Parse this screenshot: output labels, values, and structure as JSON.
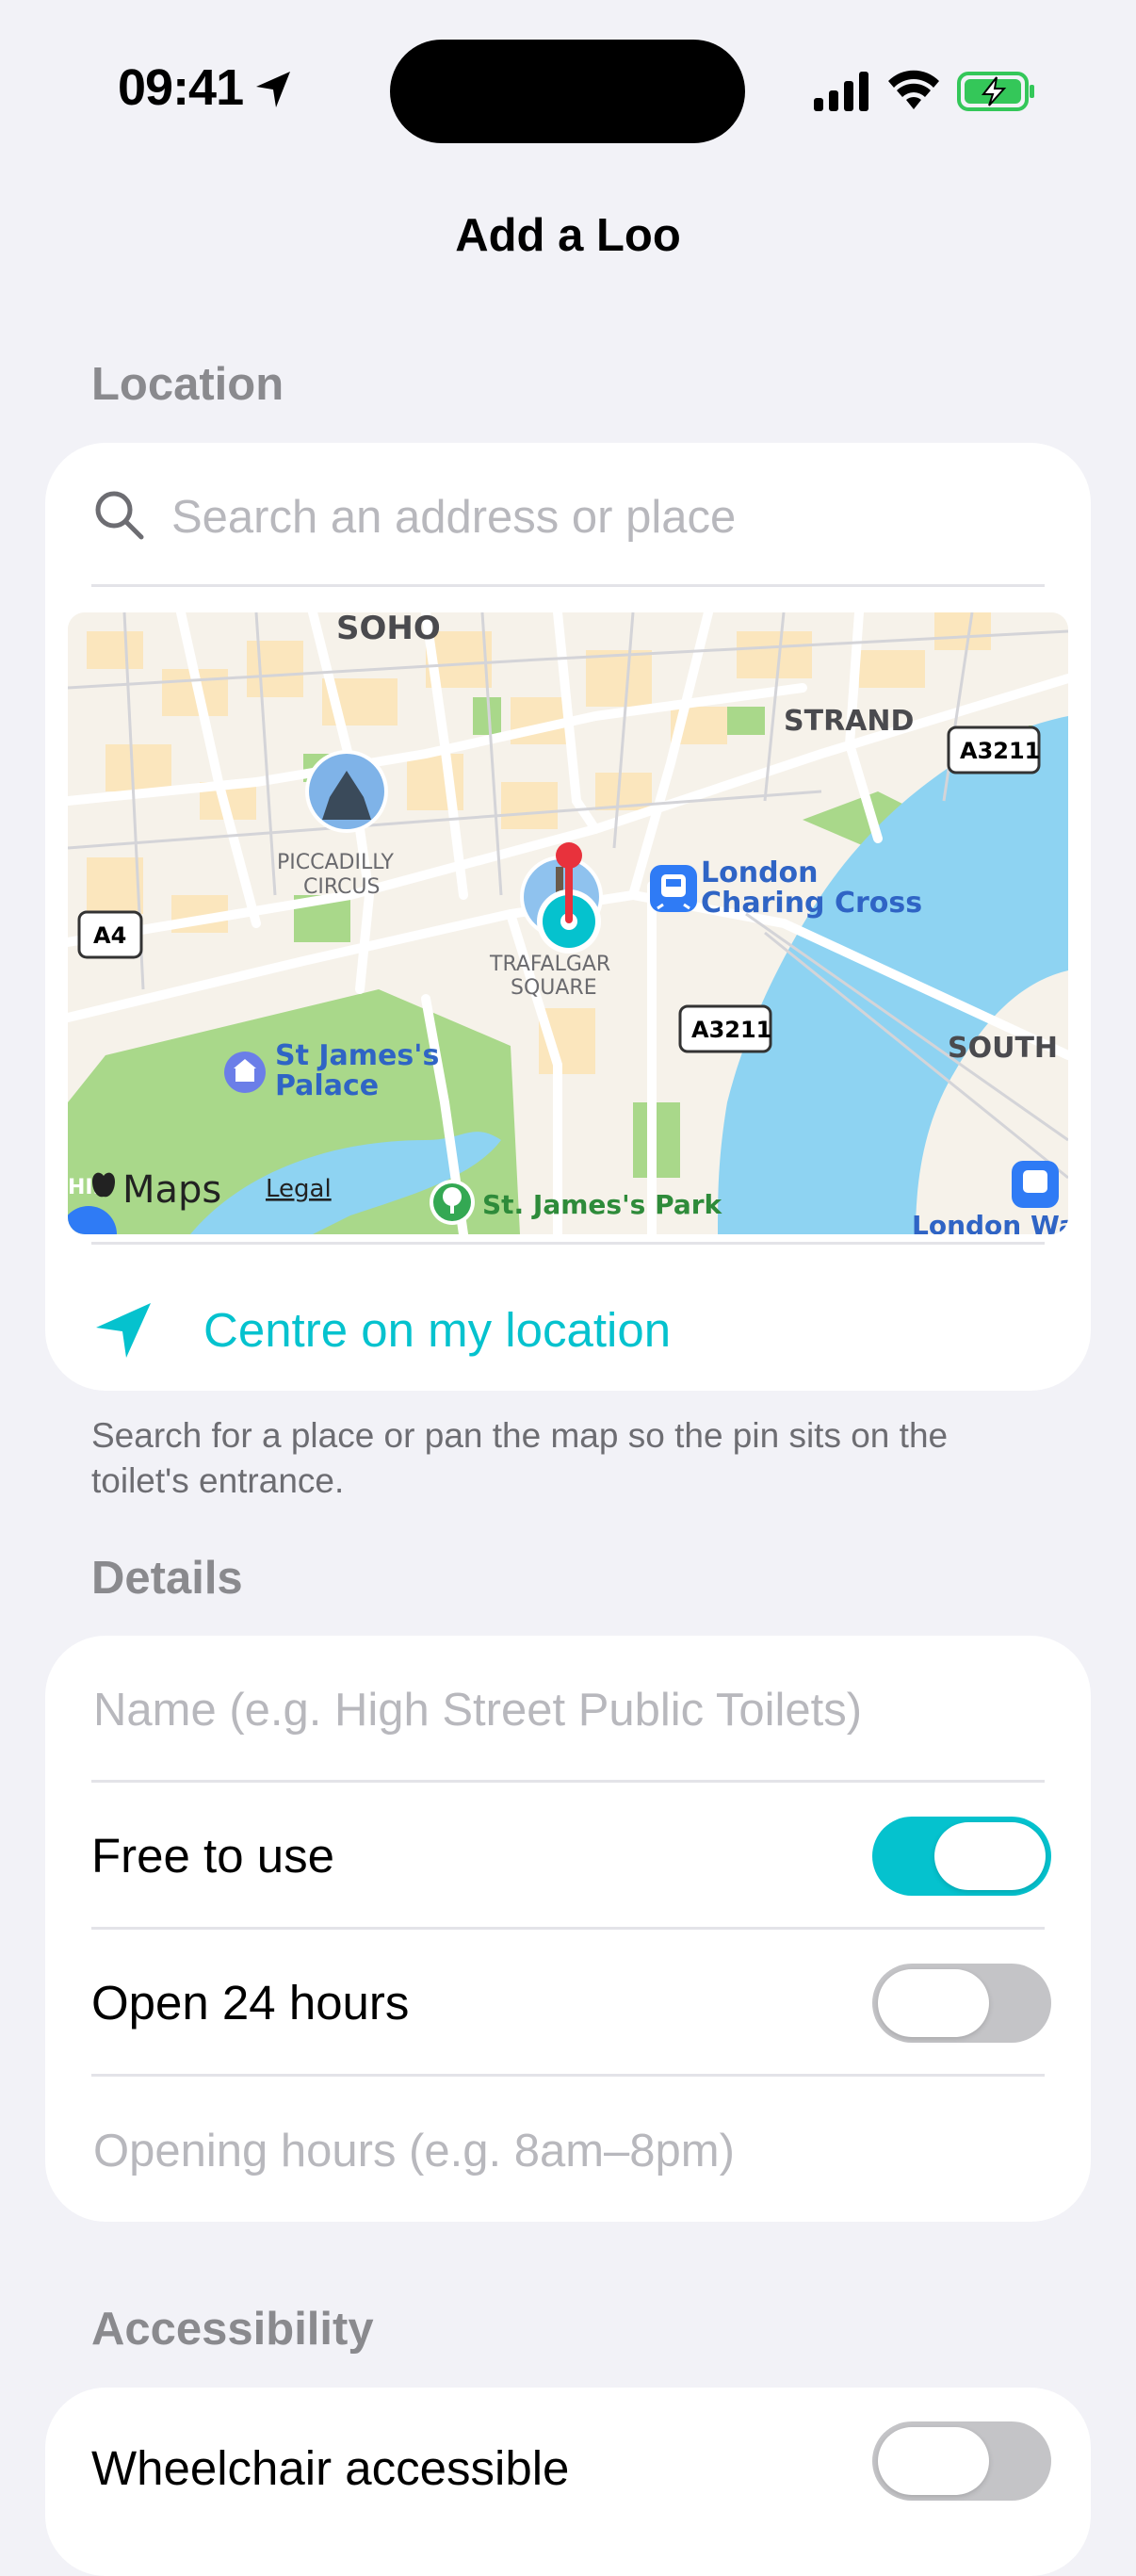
{
  "status_bar": {
    "time": "09:41"
  },
  "nav": {
    "title": "Add a Loo"
  },
  "location": {
    "header": "Location",
    "search_placeholder": "Search an address or place",
    "map": {
      "labels": {
        "soho": "SOHO",
        "strand": "STRAND",
        "a3211_top": "A3211",
        "a3211_mid": "A3211",
        "a4": "A4",
        "piccadilly_1": "PICCADILLY",
        "piccadilly_2": "CIRCUS",
        "trafalgar_1": "TRAFALGAR",
        "trafalgar_2": "SQUARE",
        "charing_1": "London",
        "charing_2": "Charing Cross",
        "stjames_palace_1": "St James's",
        "stjames_palace_2": "Palace",
        "stjames_park": "St. James's Park",
        "south_bank": "SOUTH B",
        "london_wa": "London Wa",
        "maps_logo": "Maps",
        "legal": "Legal",
        "hid": "HID"
      }
    },
    "centre_label": "Centre on my location",
    "footnote": "Search for a place or pan the map so the pin sits on the toilet's entrance."
  },
  "details": {
    "header": "Details",
    "name_placeholder": "Name (e.g. High Street Public Toilets)",
    "free_label": "Free to use",
    "free_on": true,
    "open24_label": "Open 24 hours",
    "open24_on": false,
    "hours_placeholder": "Opening hours (e.g. 8am–8pm)"
  },
  "accessibility": {
    "header": "Accessibility",
    "wheelchair_label": "Wheelchair accessible",
    "wheelchair_on": false
  },
  "colors": {
    "accent": "#05c2ce",
    "pin": "#e8323c",
    "water": "#8ed3f2",
    "park": "#a9d88a"
  }
}
